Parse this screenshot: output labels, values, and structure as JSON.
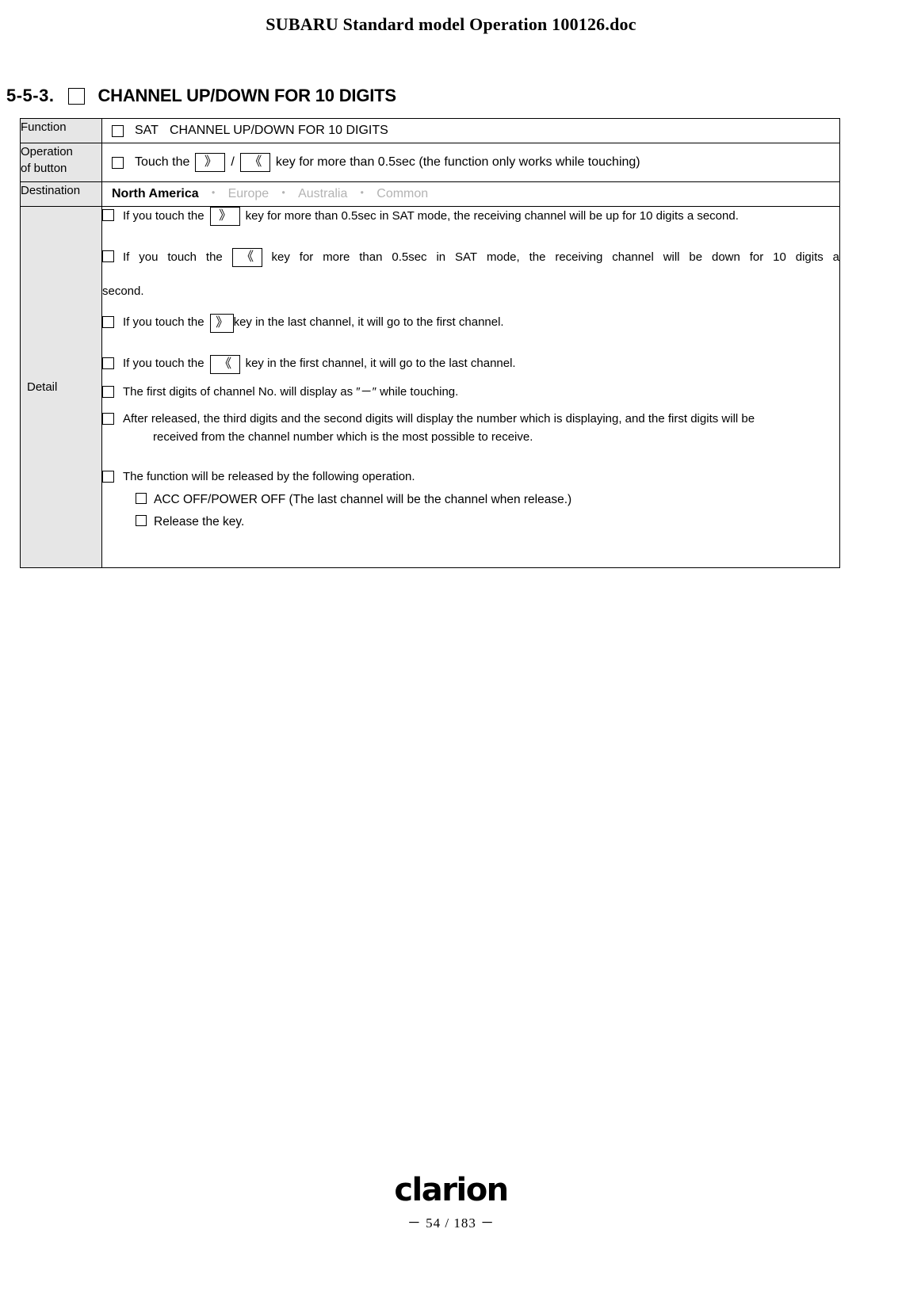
{
  "header": {
    "doc_title": "SUBARU Standard model Operation 100126.doc"
  },
  "section": {
    "number": "5-5-3.",
    "checkbox": "checkbox-empty",
    "title": "CHANNEL UP/DOWN FOR 10 DIGITS"
  },
  "table": {
    "labels": {
      "function": "Function",
      "operation_line1": "Operation",
      "operation_line2": "of button",
      "destination": "Destination",
      "detail": "Detail"
    },
    "function": {
      "prefix": "SAT",
      "text": "CHANNEL UP/DOWN FOR 10 DIGITS"
    },
    "operation": {
      "text_before": "Touch the",
      "key_up": "》",
      "separator": "/",
      "key_down": "《",
      "text_after": "key for more than 0.5sec (the function only works while touching)"
    },
    "destination": {
      "items": [
        {
          "label": "North America",
          "active": true
        },
        {
          "label": "Europe",
          "active": false
        },
        {
          "label": "Australia",
          "active": false
        },
        {
          "label": "Common",
          "active": false
        }
      ],
      "separator": "・"
    },
    "detail": {
      "item1_before": "If you touch the",
      "item1_key": "》",
      "item1_after": "key for more than 0.5sec in SAT mode, the receiving channel will be up for 10 digits a second.",
      "item2_w1": "If",
      "item2_w2": "you",
      "item2_w3": "touch",
      "item2_w4": "the",
      "item2_key": "《",
      "item2_w5": "key",
      "item2_w6": "for",
      "item2_w7": "more",
      "item2_w8": "than",
      "item2_w9": "0.5sec",
      "item2_w10": "in",
      "item2_w11": "SAT",
      "item2_w12": "mode,",
      "item2_w13": "the",
      "item2_w14": "receiving",
      "item2_w15": "channel",
      "item2_w16": "will",
      "item2_w17": "be",
      "item2_w18": "down",
      "item2_w19": "for",
      "item2_w20": "10",
      "item2_w21": "digits",
      "item2_w22": "a",
      "item2_cont": "second.",
      "item3_before": "If you touch the",
      "item3_key": "》",
      "item3_after": "key in the last channel, it will go to the first channel.",
      "item4_before": "If you touch the",
      "item4_key": "《",
      "item4_after": "key in the first channel, it will go to the last channel.",
      "item5": "The first digits of channel No. will display as ″－″ while touching.",
      "item6_line1": "After released, the third digits and the second digits will display the number which is displaying, and the first digits will be",
      "item6_line2": "received from the channel number which is the most possible to receive.",
      "item7": "The function will be released by the following operation.",
      "item7_sub1": "ACC OFF/POWER OFF (The last channel will be the channel when release.)",
      "item7_sub2": "Release the key."
    }
  },
  "footer": {
    "logo_text": "clarion",
    "page_number": "－ 54 / 183 －"
  },
  "colors": {
    "label_bg": "#e6e6e6",
    "inactive_text": "#b3b3b3",
    "border": "#000000"
  }
}
